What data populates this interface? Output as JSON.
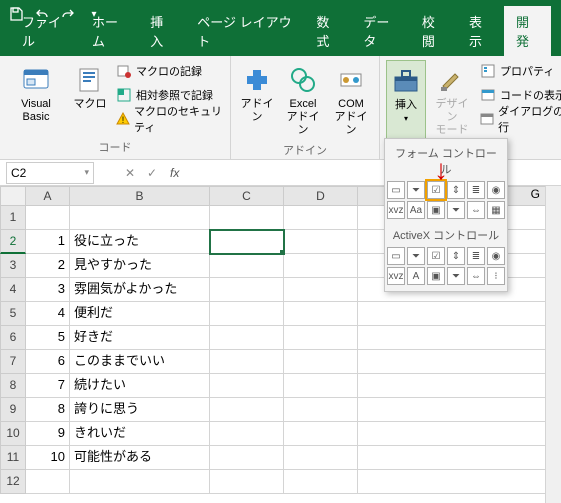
{
  "titlebar": {
    "app": "Excel"
  },
  "tabs": [
    "ファイル",
    "ホーム",
    "挿入",
    "ページ レイアウト",
    "数式",
    "データ",
    "校閲",
    "表示",
    "開発"
  ],
  "activeTab": 8,
  "ribbon": {
    "group_code_label": "コード",
    "visual_basic": "Visual Basic",
    "macros": "マクロ",
    "record_macro": "マクロの記録",
    "relative_ref": "相対参照で記録",
    "macro_security": "マクロのセキュリティ",
    "group_addins_label": "アドイン",
    "addins": "アドイン",
    "excel_addins": "Excel\nアドイン",
    "com_addins": "COM\nアドイン",
    "insert": "挿入",
    "design_mode": "デザイン\nモード",
    "properties": "プロパティ",
    "view_code": "コードの表示",
    "run_dialog": "ダイアログの実行"
  },
  "namebox": "C2",
  "dropdown": {
    "form_title": "フォーム コントロール",
    "activex_title": "ActiveX コントロール",
    "form_items": [
      "button",
      "combo",
      "check",
      "spin",
      "list",
      "radio",
      "label",
      "Aa",
      "frame",
      "combo2",
      "scroll",
      "image"
    ],
    "activex_items": [
      "button",
      "combo",
      "check",
      "spin",
      "list",
      "radio",
      "label",
      "A",
      "frame",
      "combo2",
      "scroll",
      "more"
    ]
  },
  "columns": [
    "A",
    "B",
    "C",
    "D",
    "G"
  ],
  "sheet": {
    "rows": [
      {
        "n": 1,
        "a": "",
        "b": ""
      },
      {
        "n": 2,
        "a": "1",
        "b": "役に立った",
        "sel": true
      },
      {
        "n": 3,
        "a": "2",
        "b": "見やすかった"
      },
      {
        "n": 4,
        "a": "3",
        "b": "雰囲気がよかった"
      },
      {
        "n": 5,
        "a": "4",
        "b": "便利だ"
      },
      {
        "n": 6,
        "a": "5",
        "b": "好きだ"
      },
      {
        "n": 7,
        "a": "6",
        "b": "このままでいい"
      },
      {
        "n": 8,
        "a": "7",
        "b": "続けたい"
      },
      {
        "n": 9,
        "a": "8",
        "b": "誇りに思う"
      },
      {
        "n": 10,
        "a": "9",
        "b": "きれいだ"
      },
      {
        "n": 11,
        "a": "10",
        "b": "可能性がある"
      },
      {
        "n": 12,
        "a": "",
        "b": ""
      }
    ]
  }
}
